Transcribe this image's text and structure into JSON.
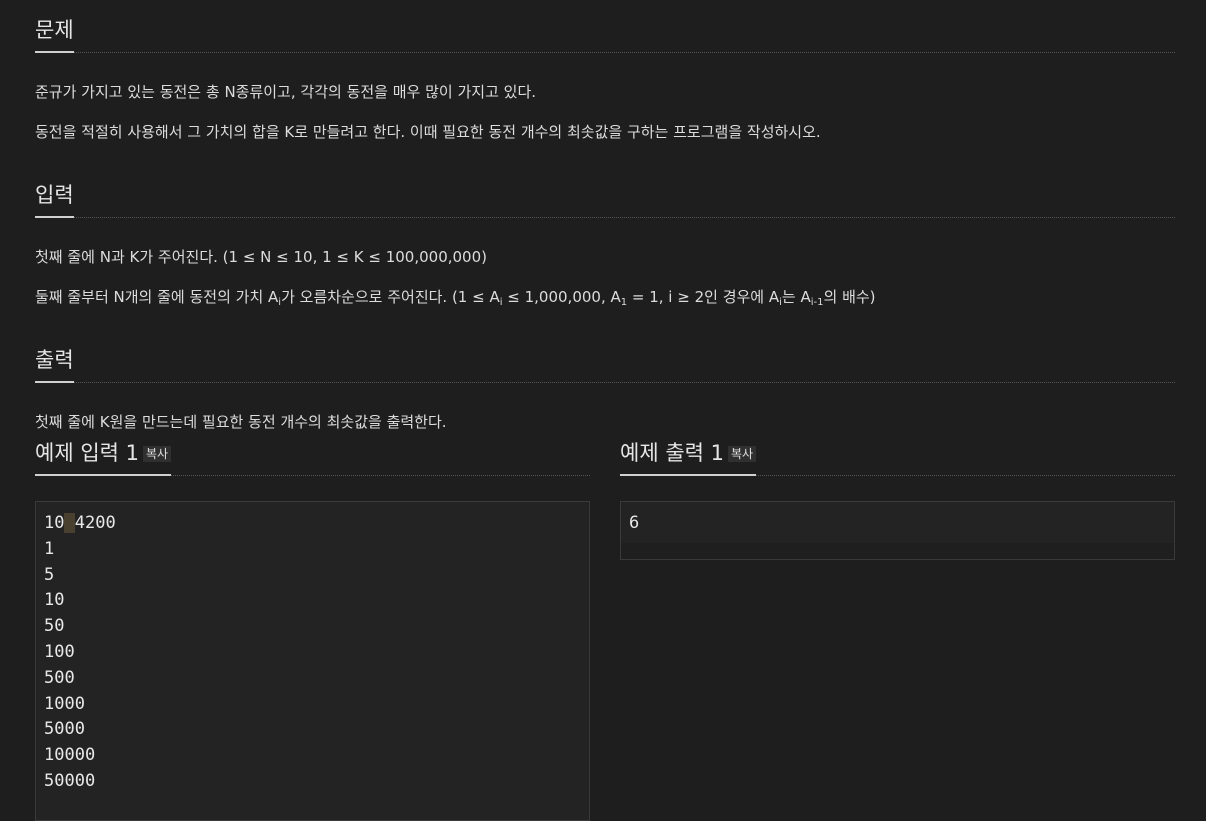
{
  "problem": {
    "title": "문제",
    "lines": [
      "준규가 가지고 있는 동전은 총 N종류이고, 각각의 동전을 매우 많이 가지고 있다.",
      "동전을 적절히 사용해서 그 가치의 합을 K로 만들려고 한다. 이때 필요한 동전 개수의 최솟값을 구하는 프로그램을 작성하시오."
    ]
  },
  "input": {
    "title": "입력",
    "line1": "첫째 줄에 N과 K가 주어진다. (1 ≤ N ≤ 10, 1 ≤ K ≤ 100,000,000)",
    "line2": {
      "p1": "둘째 줄부터 N개의 줄에 동전의 가치 A",
      "s1": "i",
      "p2": "가 오름차순으로 주어진다. (1 ≤ A",
      "s2": "i",
      "p3": " ≤ 1,000,000, A",
      "s3": "1",
      "p4": " = 1, i ≥ 2인 경우에 A",
      "s4": "i",
      "p5": "는 A",
      "s5": "i-1",
      "p6": "의 배수)"
    }
  },
  "output": {
    "title": "출력",
    "line1": "첫째 줄에 K원을 만드는데 필요한 동전 개수의 최솟값을 출력한다."
  },
  "sample_input": {
    "title": "예제 입력 1",
    "copy_label": "복사",
    "first_a": "10",
    "first_gap": " ",
    "first_b": "4200",
    "rest": "1\n5\n10\n50\n100\n500\n1000\n5000\n10000\n50000"
  },
  "sample_output": {
    "title": "예제 출력 1",
    "copy_label": "복사",
    "text": "6"
  }
}
